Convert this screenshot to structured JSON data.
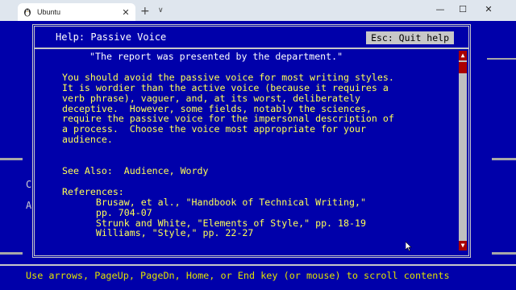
{
  "window": {
    "tab_title": "Ubuntu",
    "tab_close": "✕",
    "new_tab": "+",
    "dropdown": "∨",
    "minimize": "—",
    "maximize": "☐",
    "close": "✕"
  },
  "background": {
    "left_letter_1": "C",
    "left_letter_2": "A"
  },
  "help": {
    "title": "Help: Passive Voice",
    "quit_button": "Esc: Quit help",
    "body": "\"The report was presented by the department.\"\n\nYou should avoid the passive voice for most writing styles.\nIt is wordier than the active voice (because it requires a\nverb phrase), vaguer, and, at its worst, deliberately\ndeceptive.  However, some fields, notably the sciences,\nrequire the passive voice for the impersonal description of\na process.  Choose the voice most appropriate for your\naudience.\n\n\nSee Also:  Audience, Wordy\n\nReferences:\n      Brusaw, et al., \"Handbook of Technical Writing,\"\n      pp. 704-07\n      Strunk and White, \"Elements of Style,\" pp. 18-19\n      Williams, \"Style,\" pp. 22-27",
    "first_line": "\"The report was presented by the department.\""
  },
  "status_bar": {
    "text": "Use arrows, PageUp, PageDn, Home, or End key (or mouse) to scroll contents"
  },
  "colors": {
    "terminal_bg": "#0000aa",
    "text_yellow": "#ffff55",
    "title_white": "#ffffff",
    "scroll_red": "#aa0000",
    "frame_gray": "#c8c8c8"
  }
}
